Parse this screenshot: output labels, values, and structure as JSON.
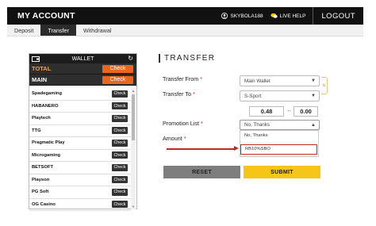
{
  "header": {
    "title": "MY ACCOUNT",
    "username": "SKYBOLA188",
    "live_help": "LIVE HELP",
    "logout": "LOGOUT"
  },
  "tabs": [
    {
      "label": "Deposit"
    },
    {
      "label": "Transfer"
    },
    {
      "label": "Withdrawal"
    }
  ],
  "wallet": {
    "title": "WALLET",
    "total_label": "TOTAL",
    "total_button": "Check",
    "main_label": "MAIN",
    "main_button": "Check",
    "providers": [
      {
        "name": "Spadegaming",
        "button": "Check"
      },
      {
        "name": "HABANERO",
        "button": "Check"
      },
      {
        "name": "Playtech",
        "button": "Check"
      },
      {
        "name": "TTG",
        "button": "Check"
      },
      {
        "name": "Pragmatic Play",
        "button": "Check"
      },
      {
        "name": "Microgaming",
        "button": "Check"
      },
      {
        "name": "BETSOFT",
        "button": "Check"
      },
      {
        "name": "Playson",
        "button": "Check"
      },
      {
        "name": "PG Soft",
        "button": "Check"
      },
      {
        "name": "OG Casino",
        "button": "Check"
      }
    ]
  },
  "transfer": {
    "title": "TRANSFER",
    "from_label": "Transfer From",
    "from_value": "Main Wallet",
    "to_label": "Transfer To",
    "to_value": "S-Sport",
    "from_amount": "0.48",
    "separator": "↔",
    "to_amount": "0.00",
    "promo_label": "Promotion List",
    "promo_value": "No, Thanks",
    "promo_options": [
      "No, Thanks",
      "RB10%SBO"
    ],
    "amount_label": "Amount",
    "required_mark": "*",
    "reset_button": "RESET",
    "submit_button": "SUBMIT"
  },
  "colors": {
    "orange": "#e8661d",
    "yellow": "#f5c518",
    "highlight": "#c42626"
  }
}
